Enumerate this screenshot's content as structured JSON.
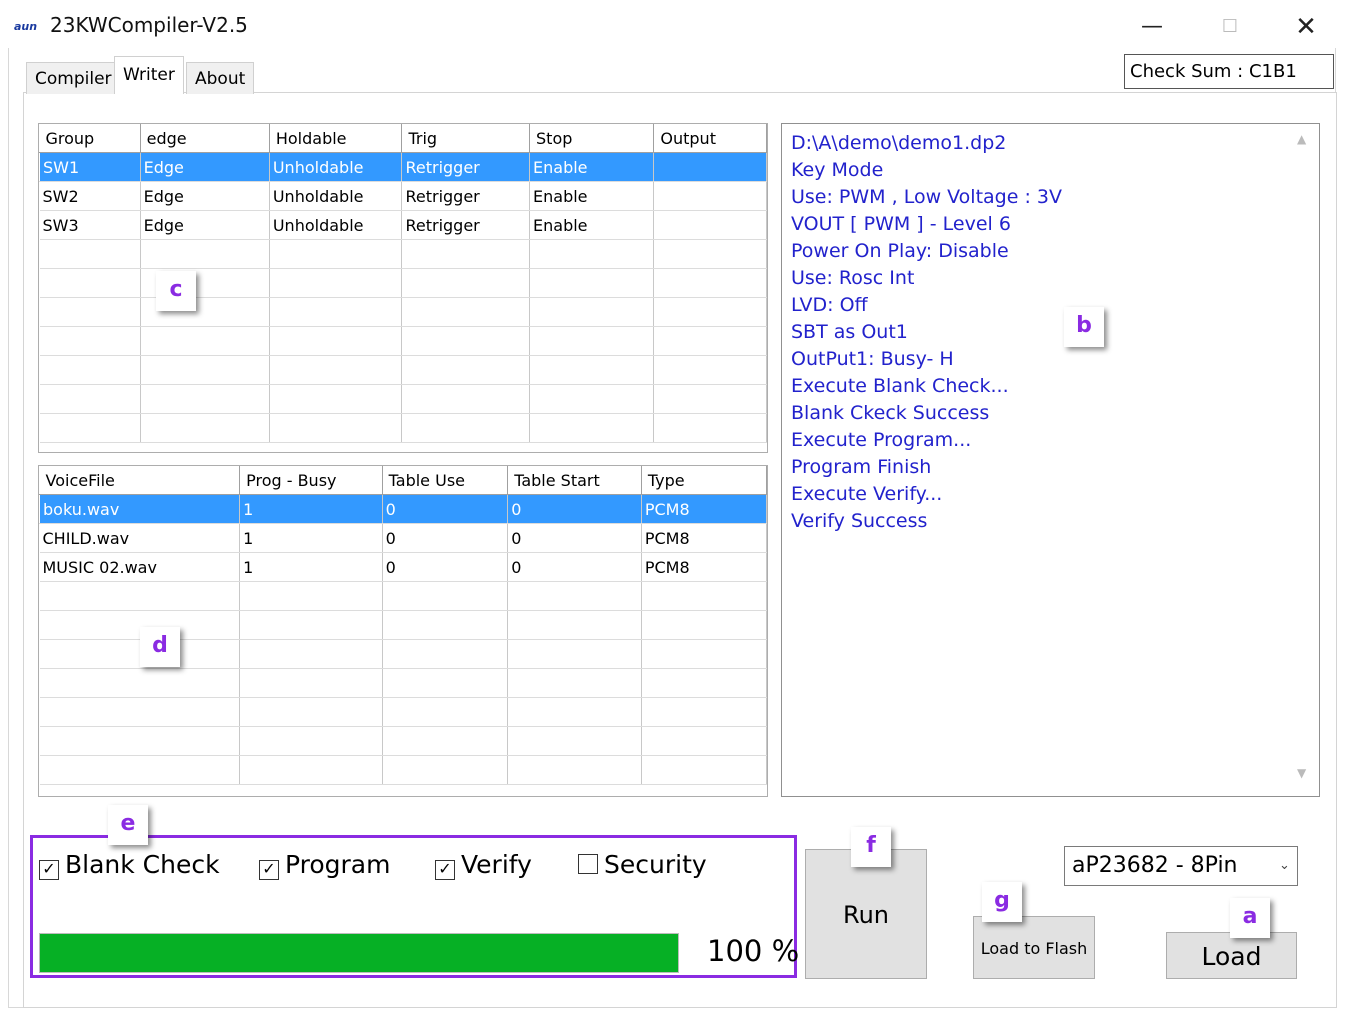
{
  "window": {
    "app_icon_text": "aun",
    "title": "23KWCompiler-V2.5",
    "minimize_glyph": "—",
    "maximize_glyph": "☐",
    "close_glyph": "✕"
  },
  "tabs": [
    {
      "label": "Compiler"
    },
    {
      "label": "Writer",
      "active": true
    },
    {
      "label": "About"
    }
  ],
  "checksum": "Check Sum : C1B1",
  "trigger_table": {
    "columns": [
      "Group",
      "edge",
      "Holdable",
      "Trig",
      "Stop",
      "Output"
    ],
    "rows": [
      [
        "SW1",
        "Edge",
        "Unholdable",
        "Retrigger",
        "Enable",
        ""
      ],
      [
        "SW2",
        "Edge",
        "Unholdable",
        "Retrigger",
        "Enable",
        ""
      ],
      [
        "SW3",
        "Edge",
        "Unholdable",
        "Retrigger",
        "Enable",
        ""
      ]
    ],
    "selected_row": 0
  },
  "voice_table": {
    "columns": [
      "VoiceFile",
      "Prog - Busy",
      "Table Use",
      "Table Start",
      "Type"
    ],
    "rows": [
      [
        "boku.wav",
        "1",
        "0",
        "0",
        "PCM8"
      ],
      [
        "CHILD.wav",
        "1",
        "0",
        "0",
        "PCM8"
      ],
      [
        "MUSIC 02.wav",
        "1",
        "0",
        "0",
        "PCM8"
      ]
    ],
    "selected_row": 0
  },
  "log": [
    "D:\\A\\demo\\demo1.dp2",
    "Key Mode",
    "Use: PWM , Low Voltage : 3V",
    "VOUT [ PWM ] - Level 6",
    "Power On Play: Disable",
    "Use: Rosc Int",
    "LVD: Off",
    "SBT as Out1",
    "OutPut1: Busy- H",
    "Execute Blank Check...",
    "Blank Ckeck Success",
    "Execute Program...",
    "Program Finish",
    "Execute Verify...",
    "Verify Success"
  ],
  "options": {
    "blank_check": {
      "label": "Blank Check",
      "checked": true
    },
    "program": {
      "label": "Program",
      "checked": true
    },
    "verify": {
      "label": "Verify",
      "checked": true
    },
    "security": {
      "label": "Security",
      "checked": false
    }
  },
  "progress": {
    "value_percent": 100,
    "text": "100 %"
  },
  "buttons": {
    "run": "Run",
    "load_to_flash": "Load to Flash",
    "load": "Load"
  },
  "chip_select": {
    "value": "aP23682 - 8Pin"
  },
  "callouts": {
    "a": "a",
    "b": "b",
    "c": "c",
    "d": "d",
    "e": "e",
    "f": "f",
    "g": "g"
  },
  "colors": {
    "accent_purple": "#8a2be2",
    "log_text": "#2222cc",
    "selection": "#3399ff",
    "progress_green": "#06b025"
  }
}
